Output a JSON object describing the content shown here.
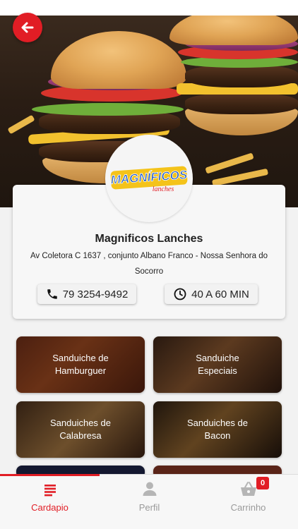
{
  "store": {
    "name": "Magnificos Lanches",
    "address": "Av Coletora C 1637 , conjunto Albano Franco - Nossa Senhora do Socorro",
    "logo_text": "MAGNÍFICOS",
    "logo_subtext": "lanches",
    "phone": "79 3254-9492",
    "delivery_time": "40 A 60 MIN"
  },
  "header": {
    "back_icon": "arrow-left-icon"
  },
  "categories": [
    {
      "label": "Sanduiche de\nHamburguer"
    },
    {
      "label": "Sanduiche\nEspeciais"
    },
    {
      "label": "Sanduiches de\nCalabresa"
    },
    {
      "label": "Sanduiches de\nBacon"
    }
  ],
  "tabs": [
    {
      "label": "Cardapio",
      "icon": "menu-list-icon",
      "active": true
    },
    {
      "label": "Perfil",
      "icon": "user-icon",
      "active": false
    },
    {
      "label": "Carrinho",
      "icon": "basket-icon",
      "active": false,
      "badge": "0"
    }
  ],
  "colors": {
    "accent": "#e11d25",
    "inactive": "#9a9a9a"
  }
}
